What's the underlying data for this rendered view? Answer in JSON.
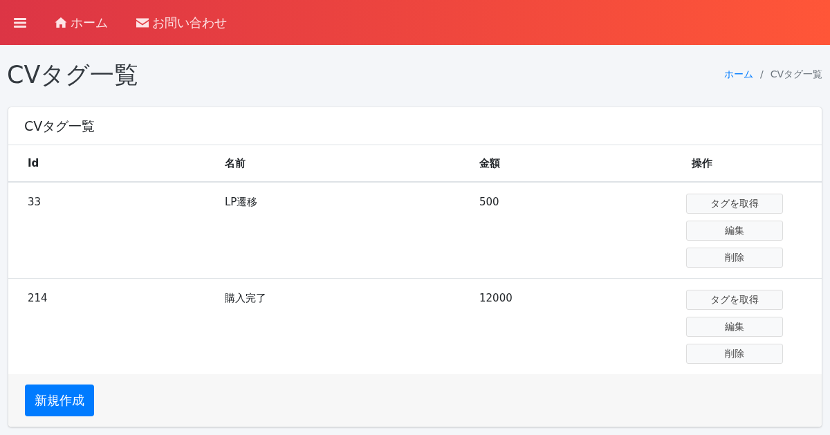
{
  "navbar": {
    "items": [
      {
        "label": "ホーム",
        "kind": "home"
      },
      {
        "label": "お問い合わせ",
        "kind": "mail"
      }
    ]
  },
  "page_title": "CVタグ一覧",
  "breadcrumb": [
    {
      "label": "ホーム",
      "kind": "link"
    },
    {
      "label": "CVタグ一覧",
      "kind": "current"
    }
  ],
  "breadcrumb_separator": "/",
  "card": {
    "title": "CVタグ一覧",
    "table": {
      "columns": [
        "Id",
        "名前",
        "金額",
        "操作"
      ],
      "rows": [
        {
          "cells": [
            "33",
            "LP遷移",
            "500"
          ],
          "actions": [
            "タグを取得",
            "編集",
            "削除"
          ]
        },
        {
          "cells": [
            "214",
            "購入完了",
            "12000"
          ],
          "actions": [
            "タグを取得",
            "編集",
            "削除"
          ]
        }
      ]
    },
    "footer_button": "新規作成"
  }
}
